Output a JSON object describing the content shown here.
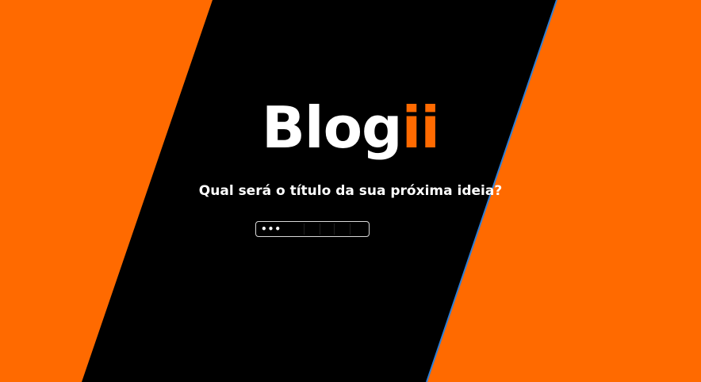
{
  "colors": {
    "accent": "#ff6a00",
    "panel": "#000000",
    "edge_line": "#2f7fd6",
    "text": "#ffffff"
  },
  "logo": {
    "main": "Blog",
    "accent": "ii"
  },
  "prompt": {
    "question": "Qual será o título da sua próxima ideia?"
  },
  "title_input": {
    "value": "",
    "placeholder": "•••"
  }
}
